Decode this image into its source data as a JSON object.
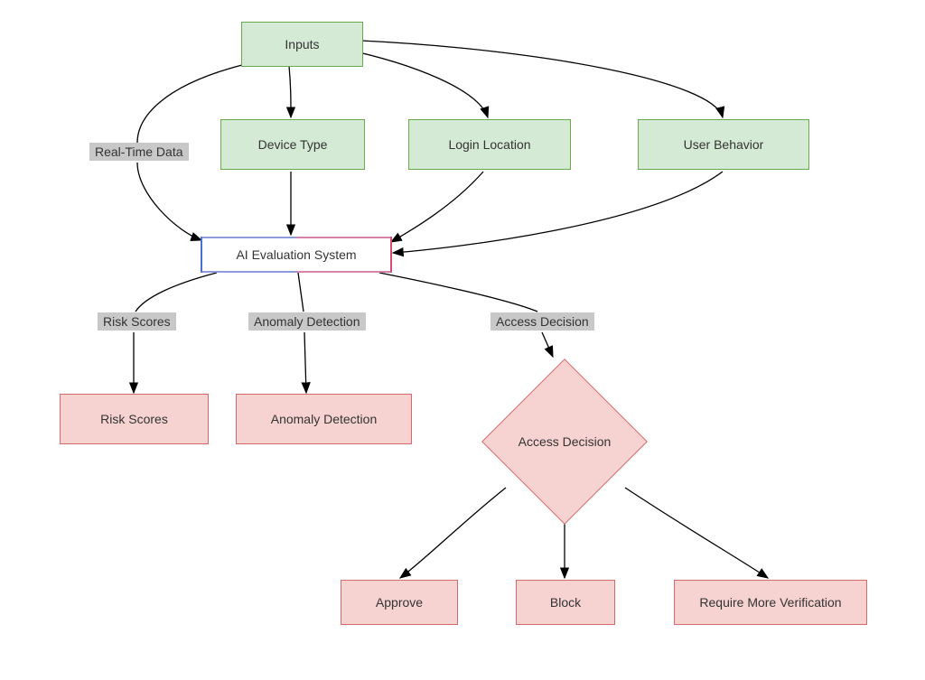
{
  "nodes": {
    "inputs": "Inputs",
    "device_type": "Device Type",
    "login_location": "Login Location",
    "user_behavior": "User Behavior",
    "ai_system": "AI Evaluation System",
    "risk_scores": "Risk Scores",
    "anomaly_detection": "Anomaly Detection",
    "access_decision": "Access Decision",
    "approve": "Approve",
    "block": "Block",
    "require_more": "Require More Verification"
  },
  "labels": {
    "real_time_data": "Real-Time Data",
    "risk_scores": "Risk Scores",
    "anomaly_detection": "Anomaly Detection",
    "access_decision": "Access Decision"
  },
  "colors": {
    "green_fill": "#d5ead5",
    "green_stroke": "#6aa84f",
    "pink_fill": "#f6d3d0",
    "pink_stroke": "#d46a6a",
    "label_bg": "#c8c8c8",
    "ai_left": "#4a6fd4",
    "ai_right": "#d84a6f"
  }
}
